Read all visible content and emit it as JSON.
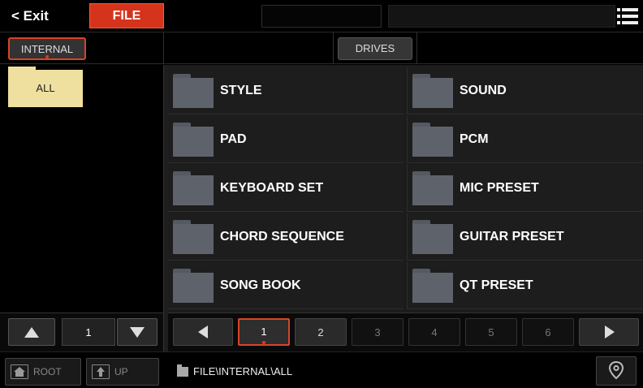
{
  "header": {
    "exit_label": "< Exit",
    "file_tab_label": "FILE",
    "menu_icon": "hamburger-menu-icon"
  },
  "device_tabs": [
    {
      "label": "INTERNAL",
      "selected": true
    },
    {
      "label": "DRIVES",
      "selected": false
    }
  ],
  "left_panel": {
    "folders": [
      {
        "label": "ALL",
        "selected": true
      }
    ],
    "page_number": "1"
  },
  "grid": {
    "items": [
      {
        "label": "STYLE"
      },
      {
        "label": "SOUND"
      },
      {
        "label": "PAD"
      },
      {
        "label": "PCM"
      },
      {
        "label": "KEYBOARD SET"
      },
      {
        "label": "MIC PRESET"
      },
      {
        "label": "CHORD SEQUENCE"
      },
      {
        "label": "GUITAR PRESET"
      },
      {
        "label": "SONG BOOK"
      },
      {
        "label": "QT PRESET"
      }
    ]
  },
  "pager": {
    "pages": [
      "1",
      "2",
      "3",
      "4",
      "5",
      "6"
    ],
    "current_page": "1"
  },
  "bottom_bar": {
    "root_label": "ROOT",
    "up_label": "UP",
    "path": "FILE\\INTERNAL\\ALL",
    "location_icon": "location-pin-icon"
  },
  "colors": {
    "accent": "#d6331c",
    "folder_selected": "#f0e0a0",
    "folder_icon": "#5e636b"
  }
}
